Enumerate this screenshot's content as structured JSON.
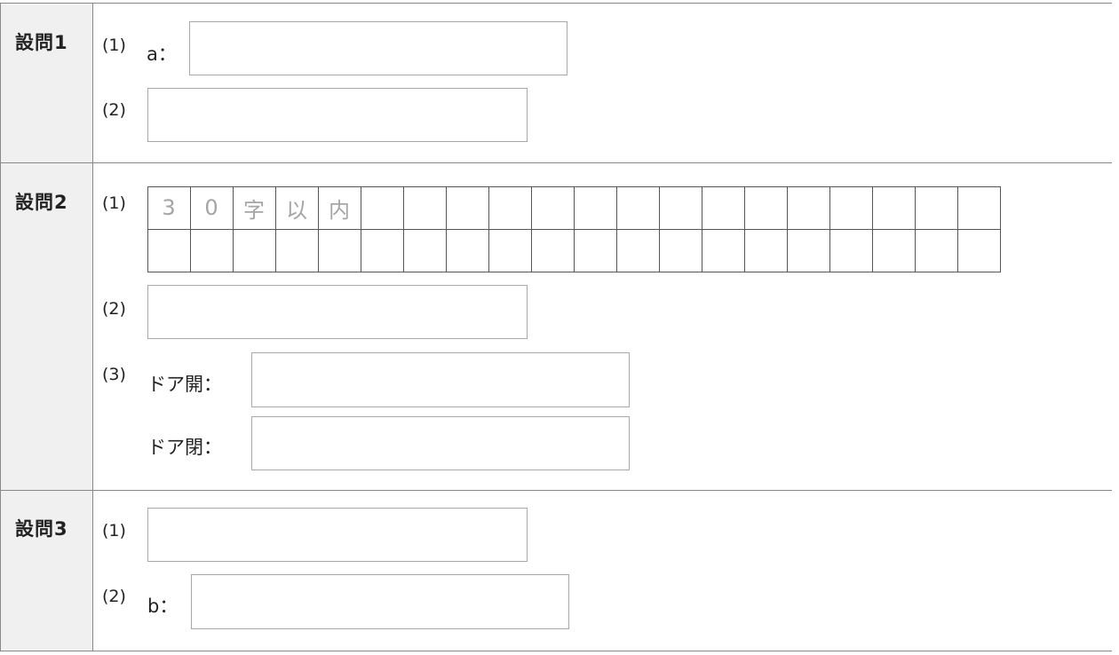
{
  "questions": [
    {
      "label": "設問1",
      "parts": [
        {
          "num": "(1)",
          "prefix": "a："
        },
        {
          "num": "(2)"
        }
      ]
    },
    {
      "label": "設問2",
      "parts": [
        {
          "num": "(1)",
          "grid": {
            "columns": 20,
            "rows": 2,
            "hint": [
              "3",
              "0",
              "字",
              "以",
              "内"
            ]
          }
        },
        {
          "num": "(2)"
        },
        {
          "num": "(3)",
          "prefix": "ドア開：",
          "prefix2": "ドア閉："
        }
      ]
    },
    {
      "label": "設問3",
      "parts": [
        {
          "num": "(1)"
        },
        {
          "num": "(2)",
          "prefix": "b："
        }
      ]
    }
  ]
}
